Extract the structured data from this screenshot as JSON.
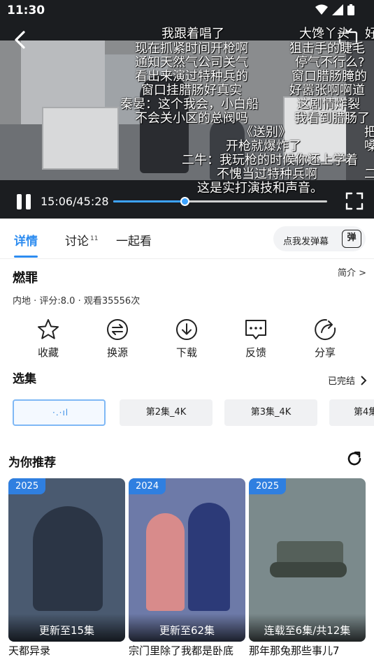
{
  "status_bar": {
    "time": "11:30"
  },
  "player": {
    "current_time": "15:06",
    "total_time": "45:28",
    "progress": 0.332,
    "danmaku": [
      "我跟着唱了",
      "大馋丫头",
      "好",
      "现在抓紧时间开枪啊",
      "狙击手的睫毛",
      "通知天然气公司关气",
      "停气不行么?",
      "看出来演过特种兵的",
      "窗口腊肠腌的",
      "窗口挂腊肠好真实",
      "好嚣张啊啊道",
      "秦晏：这个我会，小白船",
      "这剧情炸裂",
      "不会关小区的总阀吗",
      "我看到腊肠了",
      "《送别》",
      "把",
      "开枪就爆炸了",
      "嗓",
      "二牛：我玩枪的时候你还上学着",
      "不愧当过特种兵啊",
      "二",
      "这是实打演技和声音。"
    ]
  },
  "tabs": {
    "details": "详情",
    "discuss": "讨论",
    "discuss_count": "11",
    "watch_together": "一起看",
    "send_danmaku": "点我发弹幕",
    "danmaku_badge": "弹"
  },
  "info": {
    "title": "燃罪",
    "intro_link": "简介 >",
    "meta": "内地 · 评分:8.0 · 观看35556次"
  },
  "actions": [
    {
      "label": "收藏",
      "icon": "star-icon"
    },
    {
      "label": "换源",
      "icon": "switch-source-icon"
    },
    {
      "label": "下载",
      "icon": "download-icon"
    },
    {
      "label": "反馈",
      "icon": "feedback-icon"
    },
    {
      "label": "分享",
      "icon": "share-icon"
    }
  ],
  "episodes": {
    "section_title": "选集",
    "status": "已完结",
    "items": [
      "第2集_4K",
      "第3集_4K",
      "第4集"
    ]
  },
  "recommend": {
    "title": "为你推荐",
    "items": [
      {
        "year": "2025",
        "update": "更新至15集",
        "name": "天都异录",
        "color": "#4a5a70"
      },
      {
        "year": "2024",
        "update": "更新至62集",
        "name": "宗门里除了我都是卧底",
        "color": "#6d7aa8"
      },
      {
        "year": "2025",
        "update": "连载至6集/共12集",
        "name": "那年那兔那些事儿7",
        "color": "#7b8a8c"
      }
    ]
  },
  "colors": {
    "accent": "#2d8cf0",
    "year_badge": "#2f7fe0"
  }
}
